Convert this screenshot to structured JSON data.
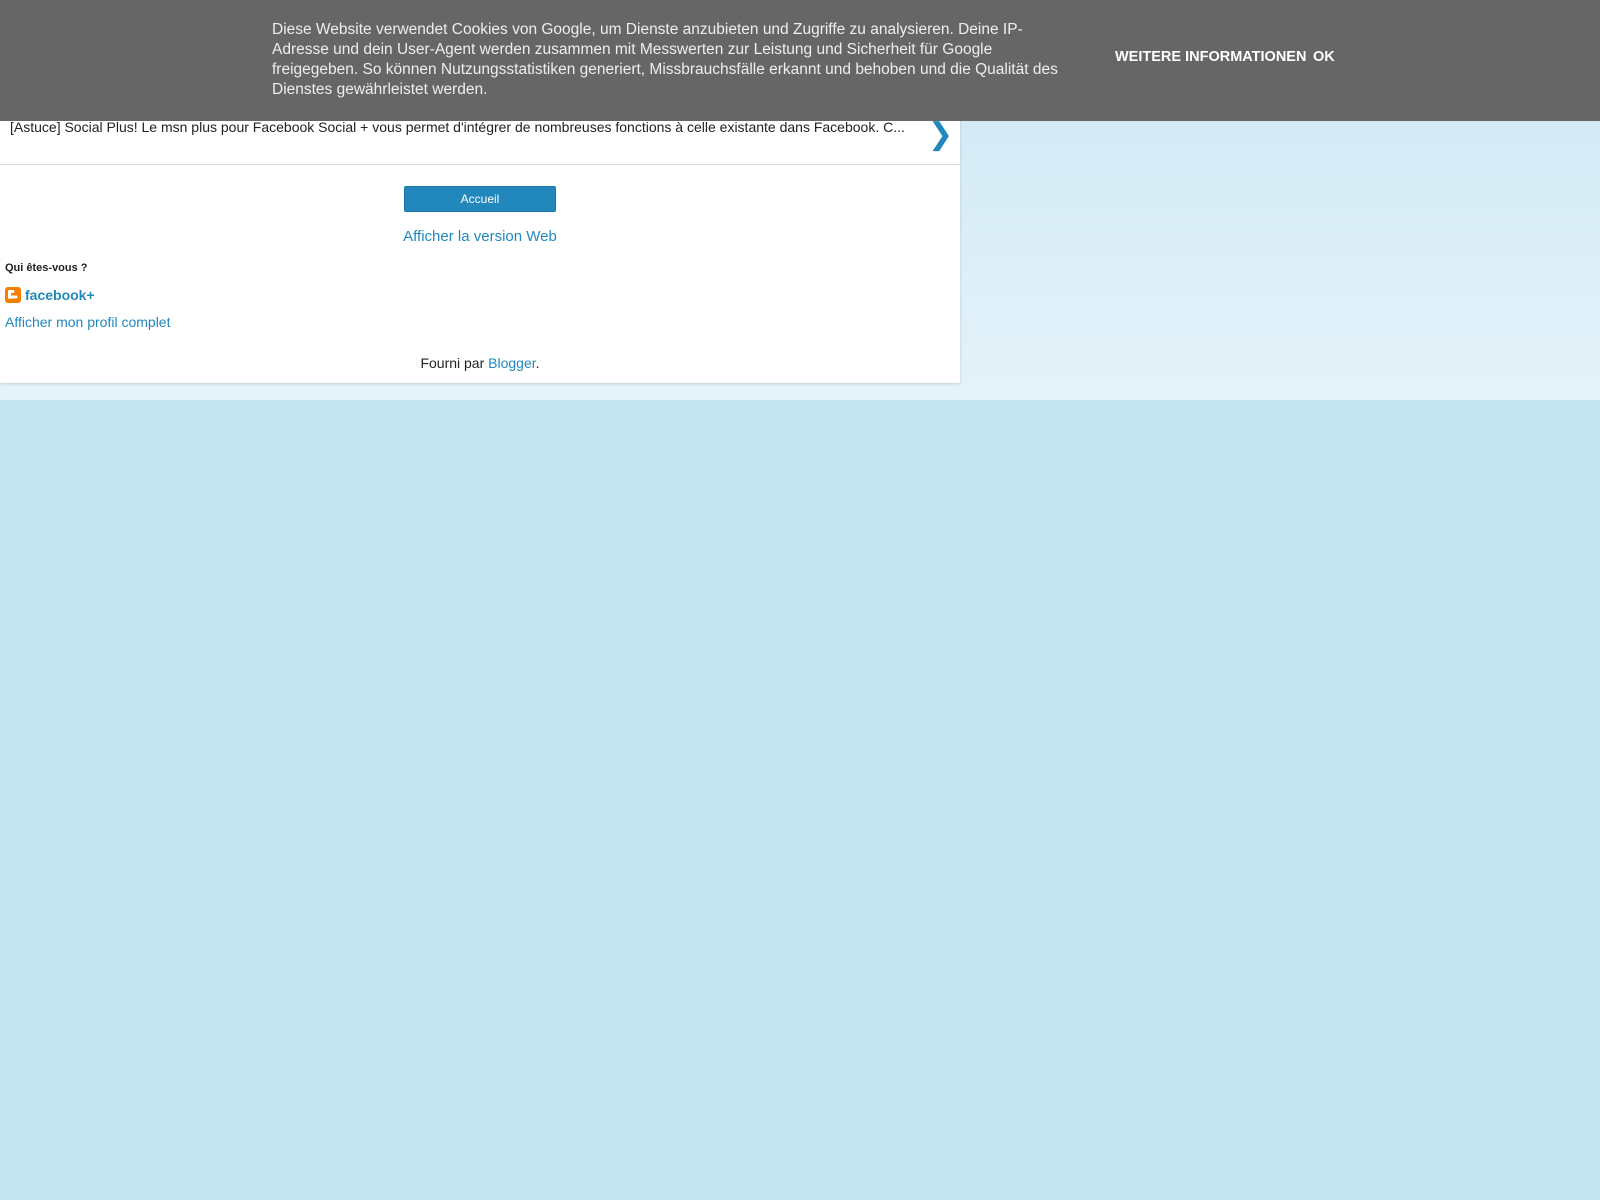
{
  "cookie_bar": {
    "message": "Diese Website verwendet Cookies von Google, um Dienste anzubieten und Zugriffe zu analysieren. Deine IP-Adresse und dein User-Agent werden zusammen mit Messwerten zur Leistung und Sicherheit für Google freigegeben. So können Nutzungsstatistiken generiert, Missbrauchsfälle erkannt und behoben und die Qualität des Dienstes gewährleistet werden.",
    "more_info_label": "WEITERE INFORMATIONEN",
    "ok_label": "OK"
  },
  "post": {
    "snippet": "[Astuce] Social Plus! Le msn plus pour Facebook Social + vous permet d'intégrer de nombreuses fonctions à celle existante dans Facebook. C...",
    "next_arrow": "❯"
  },
  "navigation": {
    "home_label": "Accueil",
    "web_version_label": "Afficher la version Web"
  },
  "profile": {
    "section_title": "Qui êtes-vous ?",
    "name": "facebook+",
    "full_profile_label": "Afficher mon profil complet"
  },
  "footer": {
    "powered_prefix": "Fourni par ",
    "powered_link": "Blogger",
    "powered_suffix": "."
  },
  "colors": {
    "link": "#2288bb",
    "background": "#c2e4f0",
    "cookie_bar": "#666666",
    "blogger_orange": "#f57d00"
  }
}
